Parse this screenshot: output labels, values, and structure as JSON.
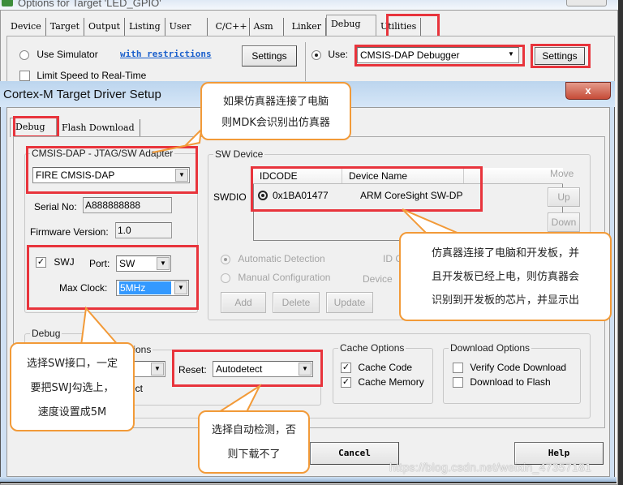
{
  "background_window": {
    "title": "Options for Target 'LED_GPIO'",
    "tabs": [
      "Device",
      "Target",
      "Output",
      "Listing",
      "User",
      "C/C++",
      "Asm",
      "Linker",
      "Debug",
      "Utilities"
    ],
    "active_tab": "Debug",
    "use_simulator_label": "Use Simulator",
    "with_restrictions_link": "with restrictions",
    "settings_left_label": "Settings",
    "limit_speed_label": "Limit Speed to Real-Time",
    "use_label": "Use:",
    "debugger_select_value": "CMSIS-DAP Debugger",
    "settings_right_label": "Settings"
  },
  "dialog": {
    "title": "Cortex-M Target Driver Setup",
    "close_label": "x",
    "tabs": [
      "Debug",
      "Flash Download"
    ],
    "active_tab": "Debug",
    "adapter_group": {
      "legend": "CMSIS-DAP - JTAG/SW Adapter",
      "adapter_value": "FIRE CMSIS-DAP",
      "serial_label": "Serial No:",
      "serial_value": "A888888888",
      "firmware_label": "Firmware Version:",
      "firmware_value": "1.0",
      "swj_label": "SWJ",
      "swj_checked": true,
      "port_label": "Port:",
      "port_value": "SW",
      "max_clock_label": "Max Clock:",
      "max_clock_value": "5MHz"
    },
    "sw_device_group": {
      "legend": "SW Device",
      "row_label": "SWDIO",
      "columns": [
        "IDCODE",
        "Device Name",
        ""
      ],
      "rows": [
        {
          "idcode": "0x1BA01477",
          "device_name": "ARM CoreSight SW-DP",
          "selected": true
        }
      ],
      "move_label": "Move",
      "up_label": "Up",
      "down_label": "Down",
      "automatic_detection_label": "Automatic Detection",
      "manual_configuration_label": "Manual Configuration",
      "id_label": "ID C",
      "device_label": "Device",
      "add_label": "Add",
      "delete_label": "Delete",
      "update_label": "Update"
    },
    "debug_group": {
      "legend": "Debug",
      "connect_legend_partial": "tions",
      "connect_partial_text": "ect",
      "reset_label": "Reset:",
      "reset_value": "Autodetect"
    },
    "cache_options": {
      "legend": "Cache Options",
      "items": [
        {
          "label": "Cache Code",
          "checked": true
        },
        {
          "label": "Cache Memory",
          "checked": true
        }
      ]
    },
    "download_options": {
      "legend": "Download Options",
      "items": [
        {
          "label": "Verify Code Download",
          "checked": false
        },
        {
          "label": "Download to Flash",
          "checked": false
        }
      ]
    },
    "buttons": {
      "cancel": "Cancel",
      "help": "Help"
    }
  },
  "annotations": {
    "callout_top": [
      "如果仿真器连接了电脑",
      "则MDK会识别出仿真器"
    ],
    "callout_right": [
      "仿真器连接了电脑和开发板，并",
      "且开发板已经上电，则仿真器会",
      "识别到开发板的芯片，并显示出"
    ],
    "callout_left": [
      "选择SW接口，一定",
      "要把SWJ勾选上，",
      "速度设置成5M"
    ],
    "callout_bottom": [
      "选择自动检测，否",
      "则下载不了"
    ],
    "highlight_color": "#e8343c",
    "callout_border_color": "#f29a38"
  },
  "watermark": "https://blog.csdn.net/weixin_47357181"
}
